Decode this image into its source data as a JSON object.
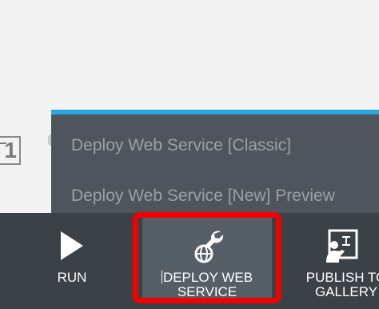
{
  "dropdown": {
    "items": [
      {
        "label": "Deploy Web Service [Classic]"
      },
      {
        "label": "Deploy Web Service [New] Preview"
      }
    ]
  },
  "toolbar": {
    "run_label": "RUN",
    "deploy_label_line1": "DEPLOY WEB",
    "deploy_label_line2": "SERVICE",
    "publish_label_line1": "PUBLISH TO",
    "publish_label_line2": "GALLERY"
  },
  "icons": {
    "run": "play-icon",
    "deploy": "wrench-globe-icon",
    "publish": "presenter-board-icon"
  },
  "colors": {
    "toolbar_bg": "#3a4147",
    "dropdown_bg": "#4e555c",
    "dropdown_accent": "#27a8e0",
    "highlight": "#f00000"
  }
}
